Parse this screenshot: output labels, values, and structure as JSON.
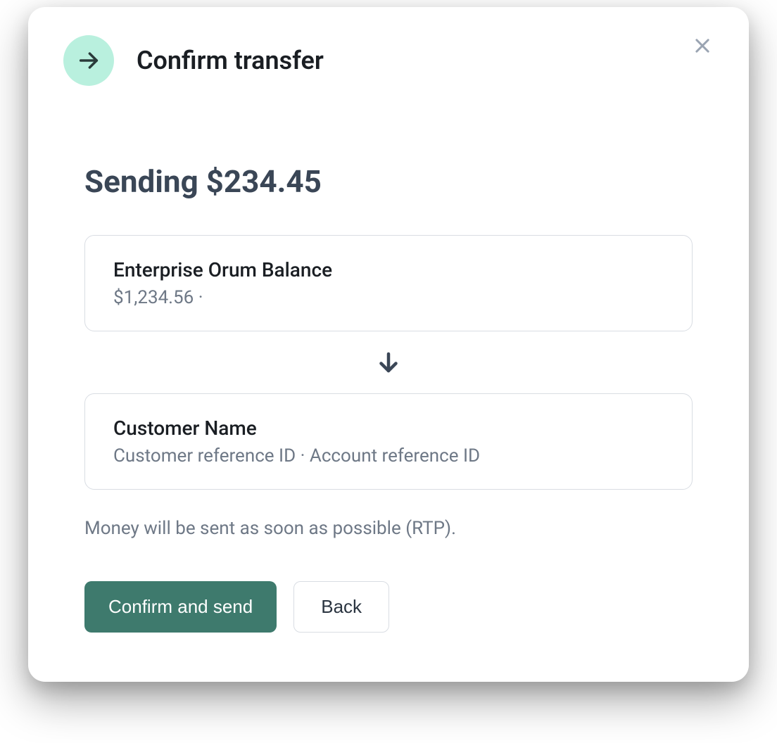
{
  "header": {
    "title": "Confirm transfer"
  },
  "content": {
    "amount_heading": "Sending $234.45",
    "source": {
      "name": "Enterprise Orum Balance",
      "detail": "$1,234.56 ·"
    },
    "destination": {
      "name": "Customer Name",
      "detail": "Customer reference ID · Account reference ID"
    },
    "note": "Money will be sent as soon as possible (RTP)."
  },
  "buttons": {
    "confirm_label": "Confirm and send",
    "back_label": "Back"
  },
  "colors": {
    "accent": "#3e7a6d",
    "icon_bg": "#b9f0de"
  }
}
